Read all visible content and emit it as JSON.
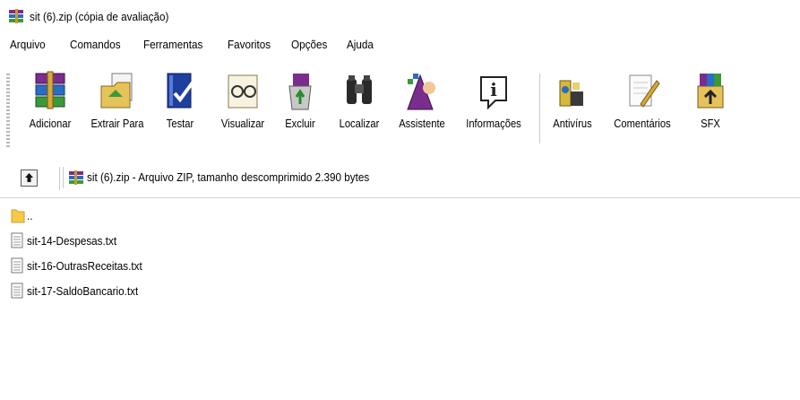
{
  "window": {
    "title": "sit (6).zip (cópia de avaliação)"
  },
  "menu": [
    "Arquivo",
    "Comandos",
    "Ferramentas",
    "Favoritos",
    "Opções",
    "Ajuda"
  ],
  "toolbar": {
    "buttons": [
      {
        "label": "Adicionar",
        "icon": "archive-books-icon"
      },
      {
        "label": "Extrair Para",
        "icon": "extract-folder-icon"
      },
      {
        "label": "Testar",
        "icon": "test-book-check-icon"
      },
      {
        "label": "Visualizar",
        "icon": "view-glasses-icon"
      },
      {
        "label": "Excluir",
        "icon": "delete-recycle-icon"
      },
      {
        "label": "Localizar",
        "icon": "binoculars-icon"
      },
      {
        "label": "Assistente",
        "icon": "wizard-icon"
      },
      {
        "label": "Informações",
        "icon": "info-icon"
      },
      {
        "label": "Antivírus",
        "icon": "antivirus-icon"
      },
      {
        "label": "Comentários",
        "icon": "comment-pen-icon"
      },
      {
        "label": "SFX",
        "icon": "sfx-box-icon"
      }
    ]
  },
  "address": {
    "text": "sit (6).zip - Arquivo ZIP, tamanho descomprimido 2.390 bytes"
  },
  "files": [
    {
      "name": "..",
      "type": "folder-up"
    },
    {
      "name": "sit-14-Despesas.txt",
      "type": "txt"
    },
    {
      "name": "sit-16-OutrasReceitas.txt",
      "type": "txt"
    },
    {
      "name": "sit-17-SaldoBancario.txt",
      "type": "txt"
    }
  ],
  "colors": {
    "accent_blue": "#1f5fbf",
    "folder_yellow": "#f7c948",
    "winrar_purple": "#7a2d8c"
  }
}
